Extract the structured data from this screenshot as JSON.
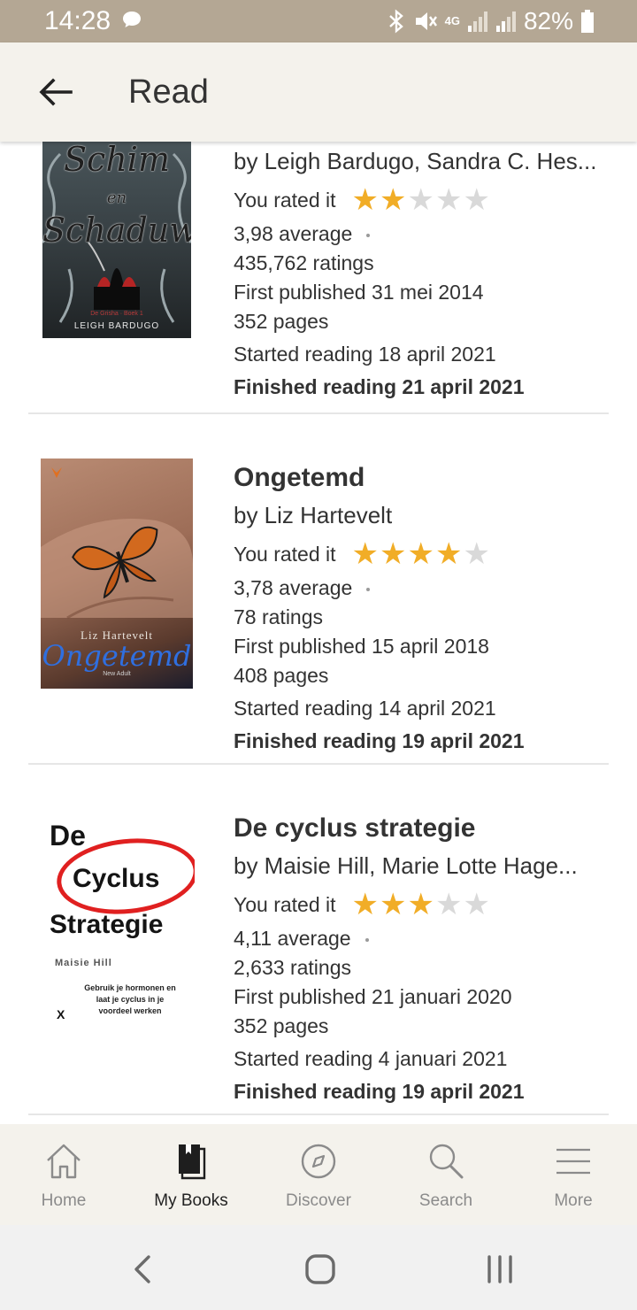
{
  "status_bar": {
    "time": "14:28",
    "battery": "82%",
    "network": "4G",
    "icons": [
      "message-icon",
      "bluetooth-icon",
      "mute-icon",
      "signal-icon",
      "battery-icon"
    ]
  },
  "app_bar": {
    "title": "Read",
    "back_icon": "arrow-left-icon"
  },
  "books": [
    {
      "title": "",
      "author": "by Leigh Bardugo, Sandra C. Hes...",
      "you_rated_label": "You rated it",
      "rating": 2,
      "max_rating": 5,
      "average": "3,98 average",
      "ratings": "435,762 ratings",
      "first_published": "First published 31 mei 2014",
      "pages": "352 pages",
      "started": "Started reading 18 april 2021",
      "finished": "Finished reading 21 april 2021",
      "cover": {
        "title": "Schim en Schaduw",
        "series": "De Grisha · Boek 1",
        "author": "LEIGH BARDUGO"
      }
    },
    {
      "title": "Ongetemd",
      "author": "by Liz Hartevelt",
      "you_rated_label": "You rated it",
      "rating": 4,
      "max_rating": 5,
      "average": "3,78 average",
      "ratings": "78 ratings",
      "first_published": "First published 15 april 2018",
      "pages": "408 pages",
      "started": "Started reading 14 april 2021",
      "finished": "Finished reading 19 april 2021",
      "cover": {
        "author": "Liz Hartevelt",
        "title": "Ongetemd",
        "note": "New Adult"
      }
    },
    {
      "title": "De cyclus strategie",
      "author": "by Maisie Hill, Marie Lotte Hage...",
      "you_rated_label": "You rated it",
      "rating": 3,
      "max_rating": 5,
      "average": "4,11 average",
      "ratings": "2,633 ratings",
      "first_published": "First published 21 januari 2020",
      "pages": "352 pages",
      "started": "Started reading 4 januari 2021",
      "finished": "Finished reading 19 april 2021",
      "cover": {
        "line1": "De",
        "line2": "Cyclus",
        "line3": "Strategie",
        "author": "Maisie Hill",
        "tagline": "Gebruik je hormonen en laat je cyclus in je voordeel werken",
        "publisher": "X"
      }
    }
  ],
  "bottom_nav": [
    {
      "label": "Home",
      "icon": "home-icon",
      "active": false
    },
    {
      "label": "My Books",
      "icon": "book-icon",
      "active": true
    },
    {
      "label": "Discover",
      "icon": "compass-icon",
      "active": false
    },
    {
      "label": "Search",
      "icon": "search-icon",
      "active": false
    },
    {
      "label": "More",
      "icon": "menu-icon",
      "active": false
    }
  ],
  "system_nav": {
    "icons": [
      "back-chevron-icon",
      "home-square-icon",
      "recents-icon"
    ]
  },
  "colors": {
    "star_on": "#f1ad27",
    "star_off": "#d9d9d9",
    "status_bar": "#b4a794",
    "app_bar": "#f4f2ec"
  }
}
